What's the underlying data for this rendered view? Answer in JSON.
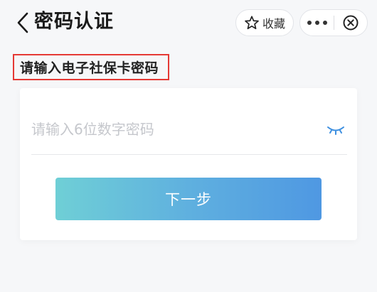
{
  "header": {
    "title": "密码认证",
    "favorite_label": "收藏",
    "icons": {
      "back": "chevron-left-icon",
      "favorite": "star-icon",
      "more": "more-dots-icon",
      "close": "close-circle-icon"
    }
  },
  "form": {
    "section_label": "请输入电子社保卡密码",
    "password_placeholder": "请输入6位数字密码",
    "password_value": "",
    "toggle_icon": "eye-closed-icon",
    "submit_label": "下一步"
  },
  "colors": {
    "accent_start": "#6fcfd6",
    "accent_end": "#4f98e2",
    "highlight_border": "#e53935",
    "eye_icon": "#3d8fe0"
  }
}
